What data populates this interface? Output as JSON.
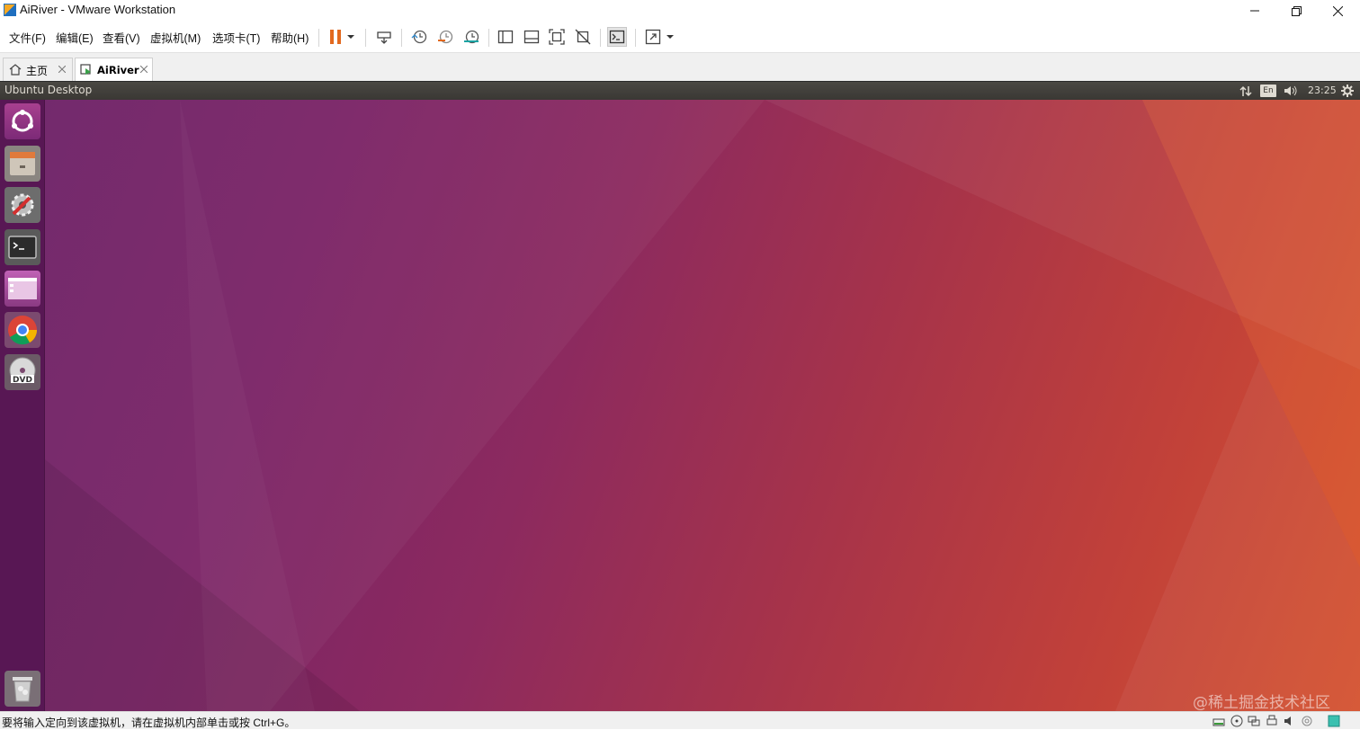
{
  "window": {
    "title": "AiRiver - VMware Workstation"
  },
  "menu": [
    "文件(F)",
    "编辑(E)",
    "查看(V)",
    "虚拟机(M)",
    "选项卡(T)",
    "帮助(H)"
  ],
  "tabs": [
    {
      "label": "主页"
    },
    {
      "label": "AiRiver"
    }
  ],
  "ubuntu": {
    "panel_title": "Ubuntu Desktop",
    "keyboard_indicator": "En",
    "clock": "23:25"
  },
  "launcher_items": [
    "ubuntu-dash-icon",
    "files-icon",
    "system-settings-icon",
    "terminal-icon",
    "software-icon",
    "chrome-icon",
    "dvd-icon",
    "trash-icon"
  ],
  "statusbar": {
    "message": "要将输入定向到该虚拟机，请在虚拟机内部单击或按 Ctrl+G。"
  },
  "watermark": "@稀土掘金技术社区",
  "colors": {
    "accent_orange": "#e2691f",
    "launcher_bg": "#5c1658",
    "desktop_left": "#6e2268",
    "desktop_right": "#d4522f"
  }
}
